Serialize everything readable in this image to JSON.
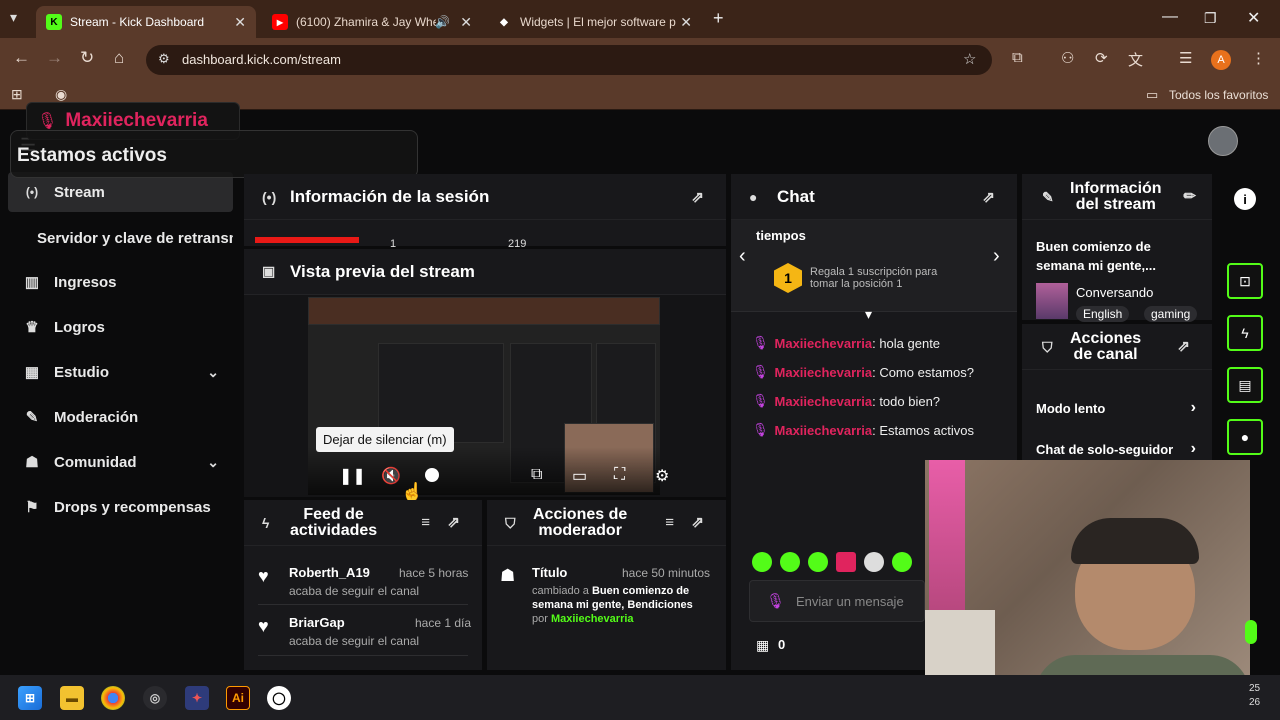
{
  "browser": {
    "tabs": [
      {
        "title": "Stream - Kick Dashboard",
        "favicon": "K",
        "active": true
      },
      {
        "title": "(6100) Zhamira & Jay Whee",
        "favicon": "▶",
        "active": false
      },
      {
        "title": "Widgets | El mejor software par",
        "favicon": "◆",
        "active": false
      }
    ],
    "new_tab": "+",
    "url": "dashboard.kick.com/stream",
    "bookmarks_label": "Todos los favoritos",
    "profile_initial": "A"
  },
  "overlay": {
    "name": "Maxiiechevarria",
    "status": "Estamos activos"
  },
  "sidebar": {
    "items": [
      {
        "label": "Stream",
        "icon": "broadcast-icon",
        "glyph": "(•)"
      },
      {
        "label": "Servidor y clave de retransm",
        "icon": "",
        "glyph": ""
      },
      {
        "label": "Ingresos",
        "icon": "chart-icon",
        "glyph": "▥"
      },
      {
        "label": "Logros",
        "icon": "trophy-icon",
        "glyph": "♛"
      },
      {
        "label": "Estudio",
        "icon": "studio-icon",
        "glyph": "▦"
      },
      {
        "label": "Moderación",
        "icon": "wrench-icon",
        "glyph": "✎"
      },
      {
        "label": "Comunidad",
        "icon": "community-icon",
        "glyph": "☗"
      },
      {
        "label": "Drops y recompensas",
        "icon": "drops-icon",
        "glyph": "⚑"
      }
    ]
  },
  "session": {
    "title": "Información de la sesión",
    "partial_values": [
      "1",
      "219"
    ]
  },
  "preview": {
    "title": "Vista previa del stream",
    "tooltip": "Dejar de silenciar (m)"
  },
  "feed": {
    "title_line1": "Feed de",
    "title_line2": "actividades",
    "items": [
      {
        "name": "Roberth_A19",
        "time": "hace 5 horas",
        "sub": "acaba de seguir el canal"
      },
      {
        "name": "BriarGap",
        "time": "hace 1 día",
        "sub": "acaba de seguir el canal"
      }
    ]
  },
  "mod_actions": {
    "title_line1": "Acciones de",
    "title_line2": "moderador",
    "item": {
      "label": "Título",
      "time": "hace 50 minutos",
      "text_a": "cambiado a ",
      "text_b": "Buen comienzo de",
      "text_c": "semana mi gente, Bendiciones",
      "text_d": "por ",
      "by": "Maxiiechevarria"
    }
  },
  "chat": {
    "title": "Chat",
    "pinned_text": "tiempos",
    "gift_badge": "1",
    "gift_line1": "Regala 1 suscripción para",
    "gift_line2": "tomar la posición 1",
    "messages": [
      {
        "user": "Maxiiechevarria",
        "text": ": hola gente"
      },
      {
        "user": "Maxiiechevarria",
        "text": ": Como estamos?"
      },
      {
        "user": "Maxiiechevarria",
        "text": ": todo bien?"
      },
      {
        "user": "Maxiiechevarria",
        "text": ": Estamos activos"
      }
    ],
    "placeholder": "Enviar un mensaje",
    "points": "0"
  },
  "stream_info": {
    "title_line1": "Información",
    "title_line2": "del stream",
    "stream_title_1": "Buen comienzo de",
    "stream_title_2": "semana mi gente,...",
    "category": "Conversando",
    "tags": [
      "English",
      "gaming"
    ]
  },
  "channel_actions": {
    "title_line1": "Acciones",
    "title_line2": "de canal",
    "items": [
      "Modo lento",
      "Chat de solo-seguidor"
    ]
  },
  "taskbar": {
    "clock_a": "25",
    "clock_b": "26"
  },
  "colors": {
    "kick_green": "#53fc18",
    "username_red": "#e0245e",
    "browser_frame": "#5a3a2a"
  }
}
